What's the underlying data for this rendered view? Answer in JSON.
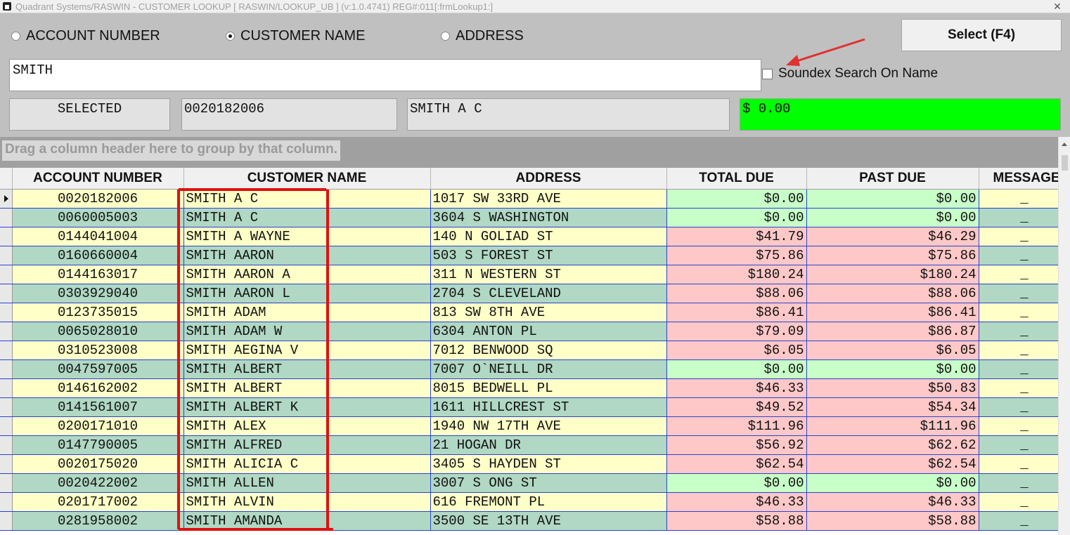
{
  "window": {
    "title": "Quadrant Systems/RASWIN - CUSTOMER LOOKUP [ RASWIN/LOOKUP_UB ] (v:1.0.4741) REG#:011[:frmLookup1:]",
    "close_glyph": "✕"
  },
  "search_mode": {
    "options": [
      {
        "label": "ACCOUNT NUMBER",
        "selected": false
      },
      {
        "label": "CUSTOMER NAME",
        "selected": true
      },
      {
        "label": "ADDRESS",
        "selected": false
      }
    ]
  },
  "select_button": {
    "label": "Select (F4)"
  },
  "search": {
    "value": "SMITH"
  },
  "soundex": {
    "label": "Soundex Search On Name",
    "checked": false
  },
  "selected_info": {
    "label": "SELECTED",
    "account": "0020182006",
    "name": "SMITH A C",
    "balance": "$ 0.00",
    "balance_color": "#00ff00"
  },
  "group_hint": "Drag a column header here to group by that column.",
  "colors": {
    "highlight": "#e01010",
    "zero_due": "#c8ffc8",
    "amount_due": "#ffc8c8"
  },
  "grid": {
    "columns": [
      "ACCOUNT NUMBER",
      "CUSTOMER NAME",
      "ADDRESS",
      "TOTAL DUE",
      "PAST DUE",
      "MESSAGE"
    ],
    "rows": [
      {
        "account": "0020182006",
        "name": "SMITH A C",
        "address": "1017 SW 33RD AVE",
        "total_due": "$0.00",
        "past_due": "$0.00",
        "message": "_"
      },
      {
        "account": "0060005003",
        "name": "SMITH A C",
        "address": "3604 S WASHINGTON",
        "total_due": "$0.00",
        "past_due": "$0.00",
        "message": "_"
      },
      {
        "account": "0144041004",
        "name": "SMITH A WAYNE",
        "address": "140 N GOLIAD ST",
        "total_due": "$41.79",
        "past_due": "$46.29",
        "message": "_"
      },
      {
        "account": "0160660004",
        "name": "SMITH AARON",
        "address": "503 S FOREST ST",
        "total_due": "$75.86",
        "past_due": "$75.86",
        "message": "_"
      },
      {
        "account": "0144163017",
        "name": "SMITH AARON A",
        "address": "311 N WESTERN ST",
        "total_due": "$180.24",
        "past_due": "$180.24",
        "message": "_"
      },
      {
        "account": "0303929040",
        "name": "SMITH AARON L",
        "address": "2704 S CLEVELAND",
        "total_due": "$88.06",
        "past_due": "$88.06",
        "message": "_"
      },
      {
        "account": "0123735015",
        "name": "SMITH ADAM",
        "address": "813 SW 8TH AVE",
        "total_due": "$86.41",
        "past_due": "$86.41",
        "message": "_"
      },
      {
        "account": "0065028010",
        "name": "SMITH ADAM W",
        "address": "6304 ANTON PL",
        "total_due": "$79.09",
        "past_due": "$86.87",
        "message": "_"
      },
      {
        "account": "0310523008",
        "name": "SMITH AEGINA V",
        "address": "7012 BENWOOD SQ",
        "total_due": "$6.05",
        "past_due": "$6.05",
        "message": "_"
      },
      {
        "account": "0047597005",
        "name": "SMITH ALBERT",
        "address": "7007 O`NEILL DR",
        "total_due": "$0.00",
        "past_due": "$0.00",
        "message": "_"
      },
      {
        "account": "0146162002",
        "name": "SMITH ALBERT",
        "address": "8015 BEDWELL PL",
        "total_due": "$46.33",
        "past_due": "$50.83",
        "message": "_"
      },
      {
        "account": "0141561007",
        "name": "SMITH ALBERT K",
        "address": "1611 HILLCREST ST",
        "total_due": "$49.52",
        "past_due": "$54.34",
        "message": "_"
      },
      {
        "account": "0200171010",
        "name": "SMITH ALEX",
        "address": "1940 NW 17TH AVE",
        "total_due": "$111.96",
        "past_due": "$111.96",
        "message": "_"
      },
      {
        "account": "0147790005",
        "name": "SMITH ALFRED",
        "address": "21 HOGAN DR",
        "total_due": "$56.92",
        "past_due": "$62.62",
        "message": "_"
      },
      {
        "account": "0020175020",
        "name": "SMITH ALICIA C",
        "address": "3405 S HAYDEN ST",
        "total_due": "$62.54",
        "past_due": "$62.54",
        "message": "_"
      },
      {
        "account": "0020422002",
        "name": "SMITH ALLEN",
        "address": "3007 S ONG ST",
        "total_due": "$0.00",
        "past_due": "$0.00",
        "message": "_"
      },
      {
        "account": "0201717002",
        "name": "SMITH ALVIN",
        "address": "616 FREMONT PL",
        "total_due": "$46.33",
        "past_due": "$46.33",
        "message": "_"
      },
      {
        "account": "0281958002",
        "name": "SMITH AMANDA",
        "address": "3500 SE 13TH AVE",
        "total_due": "$58.88",
        "past_due": "$58.88",
        "message": "_"
      }
    ]
  }
}
